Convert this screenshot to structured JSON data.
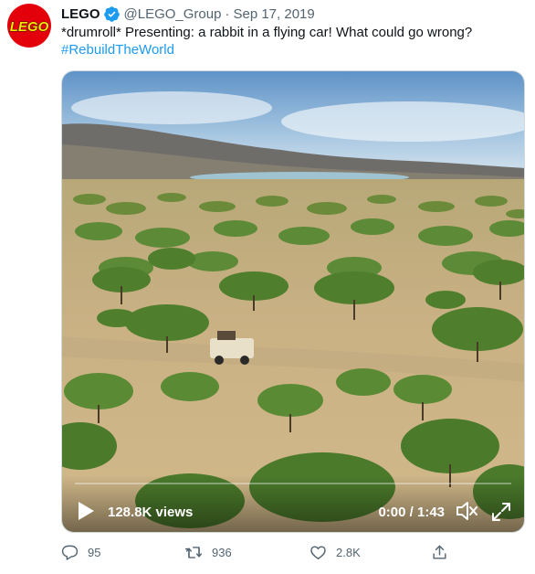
{
  "tweet": {
    "display_name": "LEGO",
    "handle": "@LEGO_Group",
    "separator": "·",
    "date": "Sep 17, 2019",
    "text": "*drumroll* Presenting: a rabbit in a flying car! What could go wrong?",
    "hashtag": "#RebuildTheWorld",
    "avatar_logo_text": "LEGO"
  },
  "video": {
    "views": "128.8K views",
    "time": "0:00 / 1:43",
    "progress": 0
  },
  "actions": {
    "replies": "95",
    "retweets": "936",
    "likes": "2.8K"
  },
  "icons": {
    "verified": "verified-badge-icon",
    "play": "play-icon",
    "volume": "volume-muted-icon",
    "fullscreen": "fullscreen-icon",
    "reply": "reply-icon",
    "retweet": "retweet-icon",
    "like": "heart-icon",
    "share": "share-icon"
  },
  "colors": {
    "brand_red": "#e3000b",
    "link_blue": "#1d9bf0",
    "muted_text": "#536471"
  }
}
